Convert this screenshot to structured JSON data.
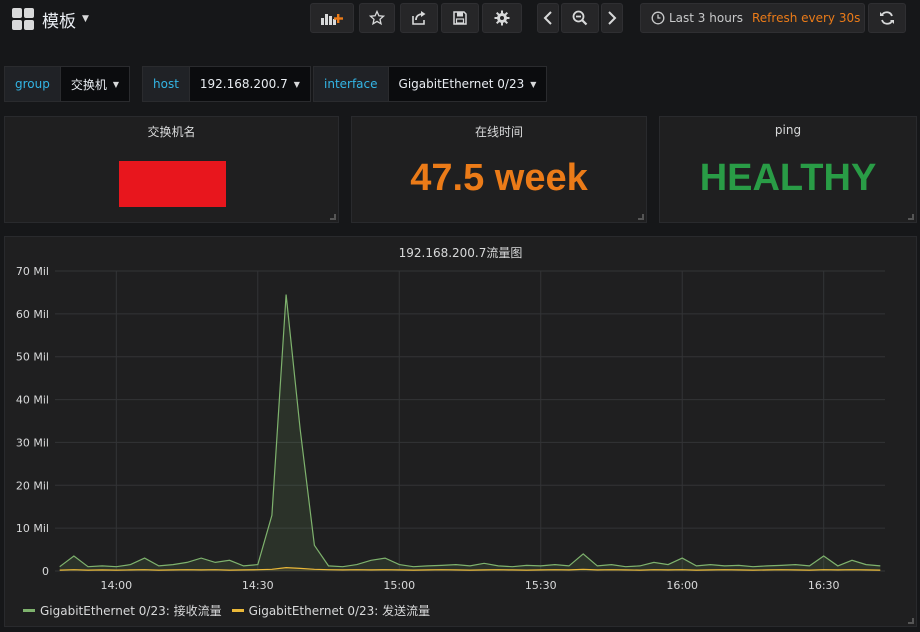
{
  "dashboard": {
    "title": "模板"
  },
  "nav": {
    "time_range": "Last 3 hours",
    "refresh": "Refresh every 30s"
  },
  "variables": [
    {
      "label": "group",
      "value": "交换机"
    },
    {
      "label": "host",
      "value": "192.168.200.7"
    },
    {
      "label": "interface",
      "value": "GigabitEthernet 0/23"
    }
  ],
  "panels": {
    "switch_name": {
      "title": "交换机名"
    },
    "uptime": {
      "title": "在线时间",
      "value": "47.5 week",
      "color": "#eb7b18"
    },
    "ping": {
      "title": "ping",
      "value": "HEALTHY",
      "color": "#299c46"
    }
  },
  "colors": {
    "accent": "#33b5e5",
    "rx": "#7eb26d",
    "tx": "#eab839"
  },
  "chart_data": {
    "type": "line",
    "title": "192.168.200.7流量图",
    "y_ticks": [
      "0",
      "10 Mil",
      "20 Mil",
      "30 Mil",
      "40 Mil",
      "50 Mil",
      "60 Mil",
      "70 Mil"
    ],
    "x_ticks": [
      "14:00",
      "14:30",
      "15:00",
      "15:30",
      "16:00",
      "16:30"
    ],
    "ylim": [
      0,
      70000000
    ],
    "x": [
      "13:48",
      "13:51",
      "13:54",
      "13:57",
      "14:00",
      "14:03",
      "14:06",
      "14:09",
      "14:12",
      "14:15",
      "14:18",
      "14:21",
      "14:24",
      "14:27",
      "14:30",
      "14:33",
      "14:36",
      "14:39",
      "14:42",
      "14:45",
      "14:48",
      "14:51",
      "14:54",
      "14:57",
      "15:00",
      "15:03",
      "15:06",
      "15:09",
      "15:12",
      "15:15",
      "15:18",
      "15:21",
      "15:24",
      "15:27",
      "15:30",
      "15:33",
      "15:36",
      "15:39",
      "15:42",
      "15:45",
      "15:48",
      "15:51",
      "15:54",
      "15:57",
      "16:00",
      "16:03",
      "16:06",
      "16:09",
      "16:12",
      "16:15",
      "16:18",
      "16:21",
      "16:24",
      "16:27",
      "16:30",
      "16:33",
      "16:36",
      "16:39",
      "16:42"
    ],
    "series": [
      {
        "name": "GigabitEthernet 0/23: 接收流量",
        "color": "#7eb26d",
        "values": [
          1000000,
          3500000,
          1000000,
          1200000,
          1000000,
          1500000,
          3000000,
          1200000,
          1500000,
          2000000,
          3000000,
          2000000,
          2500000,
          1200000,
          1500000,
          13000000,
          64500000,
          33000000,
          6000000,
          1200000,
          1000000,
          1500000,
          2500000,
          3000000,
          1500000,
          1000000,
          1200000,
          1300000,
          1500000,
          1200000,
          1800000,
          1200000,
          1000000,
          1300000,
          1200000,
          1500000,
          1200000,
          4000000,
          1200000,
          1500000,
          1000000,
          1200000,
          2000000,
          1500000,
          3000000,
          1200000,
          1500000,
          1200000,
          1300000,
          1000000,
          1200000,
          1300000,
          1500000,
          1200000,
          3500000,
          1200000,
          2500000,
          1500000,
          1200000
        ]
      },
      {
        "name": "GigabitEthernet 0/23: 发送流量",
        "color": "#eab839",
        "values": [
          200000,
          300000,
          200000,
          250000,
          200000,
          250000,
          300000,
          200000,
          250000,
          300000,
          250000,
          300000,
          200000,
          250000,
          300000,
          400000,
          800000,
          600000,
          400000,
          300000,
          250000,
          300000,
          250000,
          300000,
          250000,
          200000,
          250000,
          300000,
          250000,
          200000,
          250000,
          300000,
          250000,
          200000,
          250000,
          300000,
          250000,
          400000,
          250000,
          300000,
          250000,
          200000,
          300000,
          250000,
          300000,
          200000,
          250000,
          300000,
          250000,
          200000,
          250000,
          300000,
          250000,
          200000,
          300000,
          250000,
          300000,
          250000,
          200000
        ]
      }
    ]
  }
}
